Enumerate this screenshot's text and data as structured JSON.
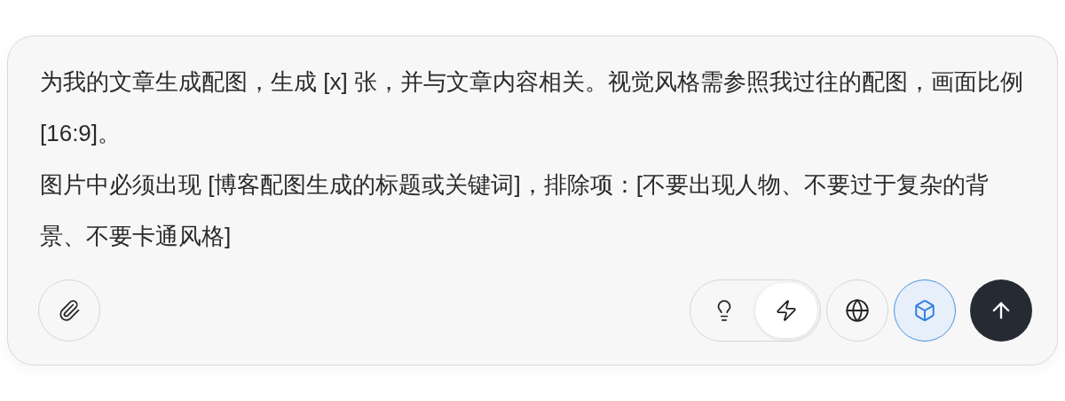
{
  "prompt": {
    "paragraphs": [
      "为我的文章生成配图，生成 [x] 张，并与文章内容相关。视觉风格需参照我过往的配图，画面比例 [16:9]。",
      "图片中必须出现 [博客配图生成的标题或关键词]，排除项：[不要出现人物、不要过于复杂的背景、不要卡通风格]"
    ]
  },
  "modes": [
    {
      "kind": "think",
      "selected": false
    },
    {
      "kind": "fast",
      "selected": true
    }
  ],
  "tools": [
    {
      "kind": "web",
      "selected": false
    },
    {
      "kind": "model",
      "selected": true
    }
  ]
}
